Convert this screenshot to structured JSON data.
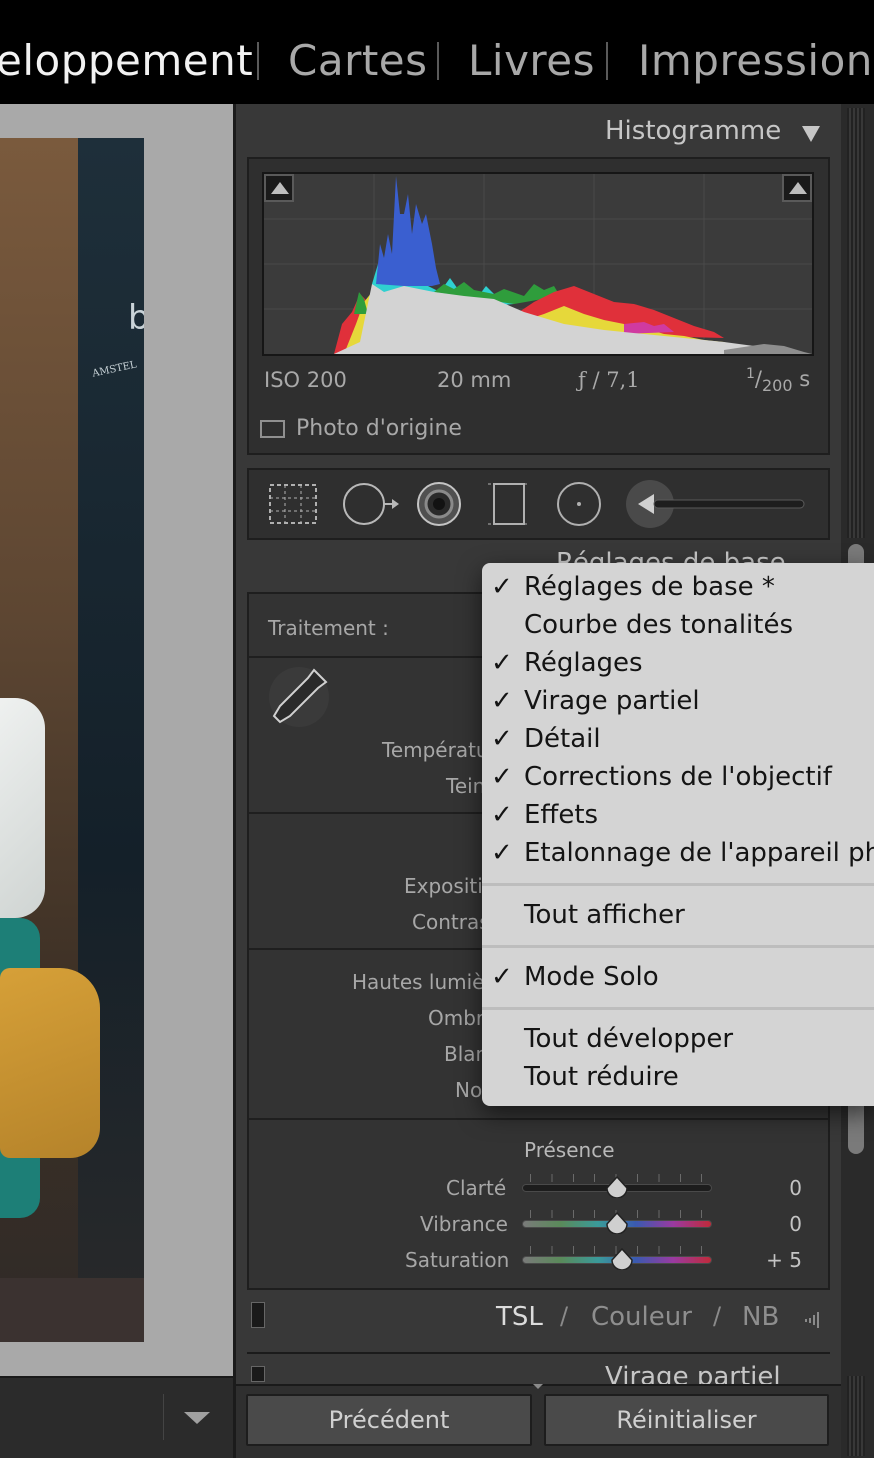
{
  "modules": [
    {
      "label": "eloppement",
      "active": true
    },
    {
      "label": "Cartes",
      "active": false
    },
    {
      "label": "Livres",
      "active": false
    },
    {
      "label": "Impression",
      "active": false
    }
  ],
  "photo": {
    "sign_text": "AMSTEL",
    "letter": "b"
  },
  "histogram": {
    "title": "Histogramme",
    "toggle_icon": "triangle-down-icon",
    "iso": "ISO 200",
    "focal": "20 mm",
    "aperture": "ƒ / 7,1",
    "shutter_num": "1",
    "shutter_den": "200",
    "shutter_unit": "s",
    "original_photo": "Photo d'origine"
  },
  "tools": [
    "crop-overlay-icon",
    "spot-removal-icon",
    "red-eye-icon",
    "graduated-filter-icon",
    "radial-filter-icon",
    "adjustment-brush-icon"
  ],
  "basic": {
    "title_partial": "Réglages de base",
    "treatment_label": "Traitement :",
    "temperature_label": "Températu",
    "tint_label": "Tein",
    "exposure_label": "Expositi",
    "contrast_label": "Contras",
    "highlights_label": "Hautes lumièr",
    "shadows_label": "Ombr",
    "whites_label": "Blan",
    "blacks_label": "No",
    "presence_title": "Présence",
    "sliders": [
      {
        "label": "Clarté",
        "value": "0",
        "fraction": 0.5
      },
      {
        "label": "Vibrance",
        "value": "0",
        "fraction": 0.5
      },
      {
        "label": "Saturation",
        "value": "+ 5",
        "fraction": 0.525
      }
    ]
  },
  "hsl": {
    "tsl": "TSL",
    "sep1": "/",
    "couleur": "Couleur",
    "sep2": "/",
    "nb": "NB"
  },
  "split_toning_partial": "Virage partiel",
  "buttons": {
    "previous": "Précédent",
    "reset": "Réinitialiser"
  },
  "menu": {
    "group1": [
      {
        "label": "Réglages de base *",
        "checked": true
      },
      {
        "label": "Courbe des tonalités",
        "checked": false
      },
      {
        "label": "Réglages",
        "checked": true
      },
      {
        "label": "Virage partiel",
        "checked": true
      },
      {
        "label": "Détail",
        "checked": true
      },
      {
        "label": "Corrections de l'objectif",
        "checked": true
      },
      {
        "label": "Effets",
        "checked": true
      },
      {
        "label": "Etalonnage de l'appareil ph",
        "checked": true
      }
    ],
    "show_all": "Tout afficher",
    "solo": {
      "label": "Mode Solo",
      "checked": true
    },
    "expand_all": "Tout développer",
    "collapse_all": "Tout réduire",
    "check_glyph": "✓"
  },
  "colors": {
    "accent_menu_bg": "#d4d4d4",
    "panel_bg": "#383838",
    "text_active": "#f2f2f2"
  }
}
